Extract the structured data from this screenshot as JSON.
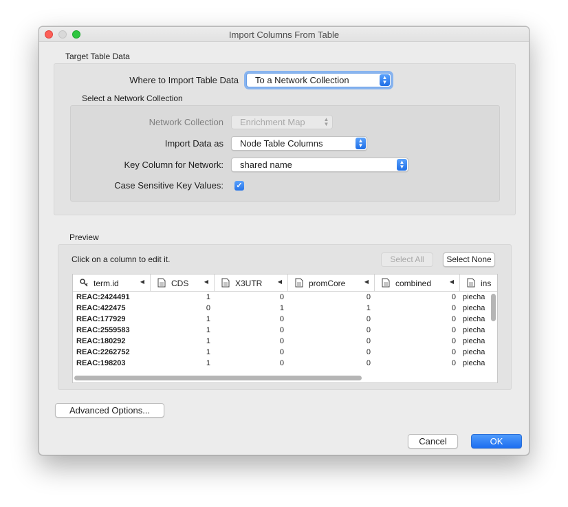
{
  "window": {
    "title": "Import Columns From Table"
  },
  "target": {
    "group_title": "Target Table Data",
    "where_label": "Where to Import Table Data",
    "where_value": "To a Network Collection",
    "collection_group_title": "Select a Network Collection",
    "network_collection_label": "Network Collection",
    "network_collection_value": "Enrichment Map",
    "import_as_label": "Import Data as",
    "import_as_value": "Node Table Columns",
    "key_column_label": "Key Column for Network:",
    "key_column_value": "shared name",
    "case_sensitive_label": "Case Sensitive Key Values:",
    "case_sensitive_checked": true
  },
  "preview": {
    "group_title": "Preview",
    "hint": "Click on a column to edit it.",
    "select_all": "Select All",
    "select_none": "Select None",
    "columns": [
      {
        "label": "term.id",
        "icon": "key-icon"
      },
      {
        "label": "CDS",
        "icon": "document-icon"
      },
      {
        "label": "X3UTR",
        "icon": "document-icon"
      },
      {
        "label": "promCore",
        "icon": "document-icon"
      },
      {
        "label": "combined",
        "icon": "document-icon"
      },
      {
        "label": "ins",
        "icon": "document-icon"
      }
    ],
    "rows": [
      [
        "REAC:2424491",
        "1",
        "0",
        "0",
        "0",
        "piecha"
      ],
      [
        "REAC:422475",
        "0",
        "1",
        "1",
        "0",
        "piecha"
      ],
      [
        "REAC:177929",
        "1",
        "0",
        "0",
        "0",
        "piecha"
      ],
      [
        "REAC:2559583",
        "1",
        "0",
        "0",
        "0",
        "piecha"
      ],
      [
        "REAC:180292",
        "1",
        "0",
        "0",
        "0",
        "piecha"
      ],
      [
        "REAC:2262752",
        "1",
        "0",
        "0",
        "0",
        "piecha"
      ],
      [
        "REAC:198203",
        "1",
        "0",
        "0",
        "0",
        "piecha"
      ]
    ]
  },
  "footer": {
    "advanced_options": "Advanced Options...",
    "cancel": "Cancel",
    "ok": "OK"
  },
  "colors": {
    "accent": "#1d6ef0",
    "close": "#fd5f57",
    "zoom": "#2ec640"
  }
}
